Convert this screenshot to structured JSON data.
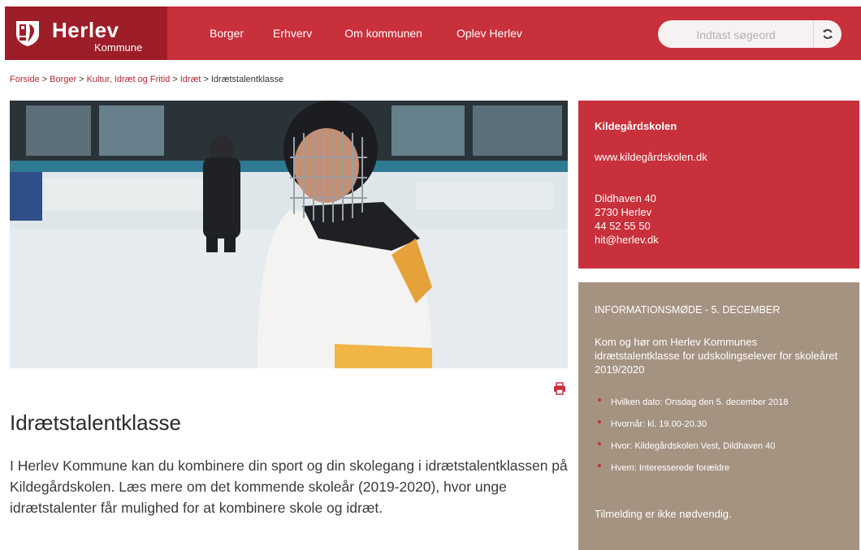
{
  "header": {
    "logo_name": "Herlev",
    "logo_sub": "Kommune",
    "nav": [
      "Borger",
      "Erhverv",
      "Om kommunen",
      "Oplev Herlev"
    ],
    "search_placeholder": "Indtast søgeord"
  },
  "breadcrumb": {
    "items": [
      "Forside",
      "Borger",
      "Kultur, Idræt og Fritid",
      "Idræt"
    ],
    "current": "Idrætstalentklasse",
    "separator": ">"
  },
  "hero": {
    "alt": "Ung ishockeyspiller med hjelm på isen"
  },
  "article": {
    "title": "Idrætstalentklasse",
    "intro": "I Herlev Kommune kan du kombinere din sport og din skolegang i idrætstalentklassen på Kildegårdskolen. Læs mere om det kommende skoleår (2019-2020), hvor unge idrætstalenter får mulighed for at kombinere skole og idræt."
  },
  "contact": {
    "title": "Kildegårdskolen",
    "website": "www.kildegårdskolen.dk",
    "address_lines": [
      "Dildhaven 40",
      "2730 Herlev",
      "44 52 55 50",
      "hit@herlev.dk"
    ]
  },
  "info": {
    "title": "INFORMATIONSMØDE - 5. DECEMBER",
    "description": "Kom og hør om Herlev Kommunes idrætstalentklasse for udskolingselever for skoleåret 2019/2020",
    "bullets": [
      "Hvilken dato: Onsdag den 5. december 2018",
      "Hvornår: kl. 19.00-20.30",
      "Hvor: Kildegårdskolen Vest, Dildhaven 40",
      "Hvem: Interesserede forældre"
    ],
    "note": "Tilmelding er ikke nødvendig."
  },
  "colors": {
    "brand_red": "#c8303b",
    "brand_dark_red": "#9d1d28",
    "info_brown": "#a59382"
  }
}
